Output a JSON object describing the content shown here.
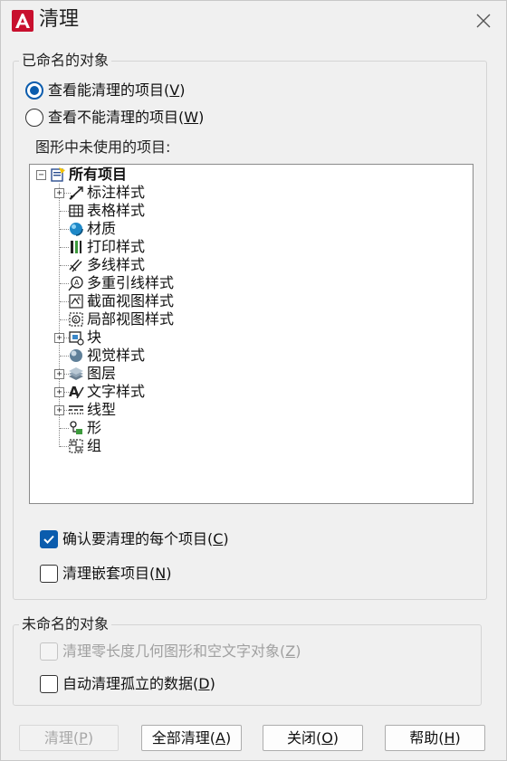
{
  "window": {
    "title": "清理",
    "icon": "autocad-a-icon",
    "close_icon": "close-icon"
  },
  "named_objects": {
    "group_label": "已命名的对象",
    "radio_view_purgeable": {
      "label": "查看能清理的项目(",
      "key": "V",
      "suffix": ")",
      "selected": true
    },
    "radio_view_nonpurgeable": {
      "label": "查看不能清理的项目(",
      "key": "W",
      "suffix": ")",
      "selected": false
    },
    "tree_label": "图形中未使用的项目:",
    "tree": {
      "root": "所有项目",
      "items": [
        {
          "label": "标注样式",
          "icon": "dimension-style-icon",
          "expandable": true
        },
        {
          "label": "表格样式",
          "icon": "table-style-icon",
          "expandable": false
        },
        {
          "label": "材质",
          "icon": "material-icon",
          "expandable": false
        },
        {
          "label": "打印样式",
          "icon": "plot-style-icon",
          "expandable": false
        },
        {
          "label": "多线样式",
          "icon": "multiline-style-icon",
          "expandable": false
        },
        {
          "label": "多重引线样式",
          "icon": "multileader-style-icon",
          "expandable": false
        },
        {
          "label": "截面视图样式",
          "icon": "section-view-style-icon",
          "expandable": false
        },
        {
          "label": "局部视图样式",
          "icon": "detail-view-style-icon",
          "expandable": false
        },
        {
          "label": "块",
          "icon": "block-icon",
          "expandable": true
        },
        {
          "label": "视觉样式",
          "icon": "visual-style-icon",
          "expandable": false
        },
        {
          "label": "图层",
          "icon": "layer-icon",
          "expandable": true
        },
        {
          "label": "文字样式",
          "icon": "text-style-icon",
          "expandable": true
        },
        {
          "label": "线型",
          "icon": "linetype-icon",
          "expandable": true
        },
        {
          "label": "形",
          "icon": "shape-icon",
          "expandable": false
        },
        {
          "label": "组",
          "icon": "group-icon",
          "expandable": false
        }
      ]
    },
    "check_confirm": {
      "label": "确认要清理的每个项目(",
      "key": "C",
      "suffix": ")",
      "checked": true
    },
    "check_nested": {
      "label": "清理嵌套项目(",
      "key": "N",
      "suffix": ")",
      "checked": false
    }
  },
  "unnamed_objects": {
    "group_label": "未命名的对象",
    "check_zero_length": {
      "label": "清理零长度几何图形和空文字对象(",
      "key": "Z",
      "suffix": ")",
      "checked": false,
      "enabled": false
    },
    "check_orphaned": {
      "label": "自动清理孤立的数据(",
      "key": "D",
      "suffix": ")",
      "checked": false
    }
  },
  "buttons": {
    "purge": {
      "label": "清理(",
      "key": "P",
      "suffix": ")",
      "enabled": false
    },
    "purge_all": {
      "label": "全部清理(",
      "key": "A",
      "suffix": ")"
    },
    "close": {
      "label": "关闭(",
      "key": "O",
      "suffix": ")"
    },
    "help": {
      "label": "帮助(",
      "key": "H",
      "suffix": ")"
    }
  },
  "colors": {
    "accent": "#0b5cad",
    "app_icon_red": "#c8102e",
    "background": "#f0f0f0"
  }
}
